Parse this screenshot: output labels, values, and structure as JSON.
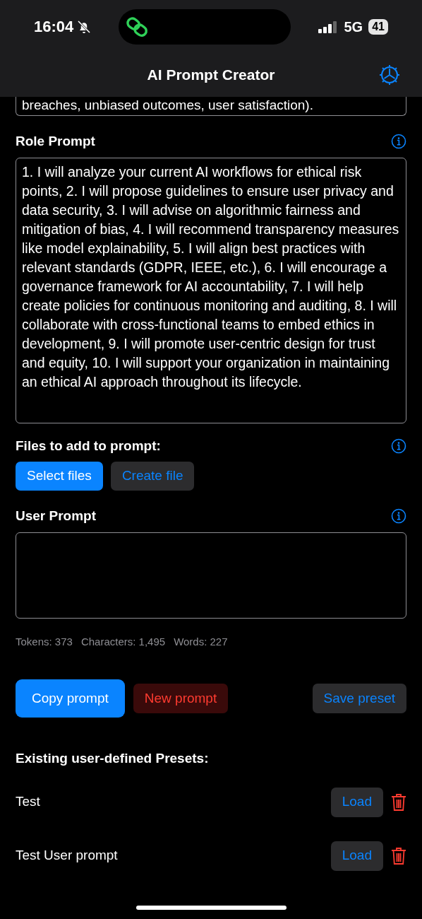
{
  "status_bar": {
    "time": "16:04",
    "network": "5G",
    "battery": "41"
  },
  "nav_bar": {
    "title": "AI Prompt Creator"
  },
  "previous_field": {
    "value": "breaches, unbiased outcomes, user satisfaction)."
  },
  "role_prompt": {
    "label": "Role Prompt",
    "value": "1. I will analyze your current AI workflows for ethical risk points, 2. I will propose guidelines to ensure user privacy and data security, 3. I will advise on algorithmic fairness and mitigation of bias, 4. I will recommend transparency measures like model explainability, 5. I will align best practices with relevant standards (GDPR, IEEE, etc.), 6. I will encourage a governance framework for AI accountability, 7. I will help create policies for continuous monitoring and auditing, 8. I will collaborate with cross-functional teams to embed ethics in development, 9. I will promote user-centric design for trust and equity, 10. I will support your organization in maintaining an ethical AI approach throughout its lifecycle."
  },
  "files": {
    "label": "Files to add to prompt:",
    "buttons": [
      {
        "label": "Select files",
        "kind": "primary"
      },
      {
        "label": "Create file",
        "kind": "secondary"
      }
    ]
  },
  "user_prompt": {
    "label": "User Prompt"
  },
  "stats": [
    "Tokens: 373",
    "Characters: 1,495",
    "Words: 227"
  ],
  "actions": [
    {
      "label": "Copy prompt",
      "kind": "primary"
    },
    {
      "label": "New prompt",
      "kind": "destructive"
    },
    {
      "label": "Save preset",
      "kind": "secondary"
    }
  ],
  "presets": {
    "heading": "Existing user-defined Presets:",
    "items": [
      {
        "name": "Test",
        "load": "Load"
      },
      {
        "name": "Test User prompt",
        "load": "Load"
      }
    ]
  }
}
